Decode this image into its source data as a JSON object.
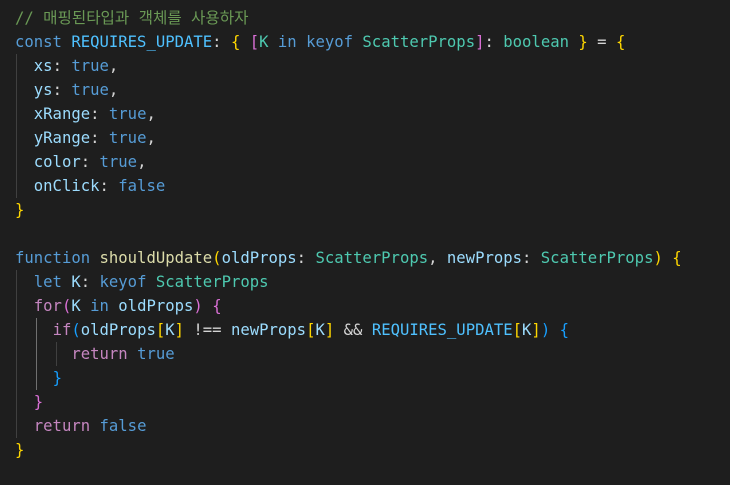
{
  "editor": {
    "colors": {
      "background": "#1e1e1e",
      "comment": "#6a9955",
      "keyword": "#569cd6",
      "control": "#c586c0",
      "variable": "#9cdcfe",
      "constant": "#4fc1ff",
      "type": "#4ec9b0",
      "function": "#dcdcaa",
      "bracket_gold": "#ffd700",
      "bracket_purple": "#da70d6",
      "bracket_blue": "#179fff",
      "plain": "#d4d4d4"
    },
    "lines": [
      [
        {
          "t": "// 매핑된타입과 객체를 사용하자",
          "c": "comment"
        }
      ],
      [
        {
          "t": "const",
          "c": "keyword"
        },
        {
          "t": " ",
          "c": "plain"
        },
        {
          "t": "REQUIRES_UPDATE",
          "c": "constant"
        },
        {
          "t": ": ",
          "c": "plain"
        },
        {
          "t": "{",
          "c": "bracket_gold"
        },
        {
          "t": " ",
          "c": "plain"
        },
        {
          "t": "[",
          "c": "bracket_purple"
        },
        {
          "t": "K",
          "c": "type"
        },
        {
          "t": " ",
          "c": "plain"
        },
        {
          "t": "in",
          "c": "keyword"
        },
        {
          "t": " ",
          "c": "plain"
        },
        {
          "t": "keyof",
          "c": "keyword"
        },
        {
          "t": " ",
          "c": "plain"
        },
        {
          "t": "ScatterProps",
          "c": "type"
        },
        {
          "t": "]",
          "c": "bracket_purple"
        },
        {
          "t": ": ",
          "c": "plain"
        },
        {
          "t": "boolean",
          "c": "type"
        },
        {
          "t": " ",
          "c": "plain"
        },
        {
          "t": "}",
          "c": "bracket_gold"
        },
        {
          "t": " = ",
          "c": "plain"
        },
        {
          "t": "{",
          "c": "bracket_gold"
        }
      ],
      [
        {
          "t": "  ",
          "c": "plain"
        },
        {
          "t": "xs",
          "c": "variable"
        },
        {
          "t": ": ",
          "c": "plain"
        },
        {
          "t": "true",
          "c": "keyword"
        },
        {
          "t": ",",
          "c": "plain"
        }
      ],
      [
        {
          "t": "  ",
          "c": "plain"
        },
        {
          "t": "ys",
          "c": "variable"
        },
        {
          "t": ": ",
          "c": "plain"
        },
        {
          "t": "true",
          "c": "keyword"
        },
        {
          "t": ",",
          "c": "plain"
        }
      ],
      [
        {
          "t": "  ",
          "c": "plain"
        },
        {
          "t": "xRange",
          "c": "variable"
        },
        {
          "t": ": ",
          "c": "plain"
        },
        {
          "t": "true",
          "c": "keyword"
        },
        {
          "t": ",",
          "c": "plain"
        }
      ],
      [
        {
          "t": "  ",
          "c": "plain"
        },
        {
          "t": "yRange",
          "c": "variable"
        },
        {
          "t": ": ",
          "c": "plain"
        },
        {
          "t": "true",
          "c": "keyword"
        },
        {
          "t": ",",
          "c": "plain"
        }
      ],
      [
        {
          "t": "  ",
          "c": "plain"
        },
        {
          "t": "color",
          "c": "variable"
        },
        {
          "t": ": ",
          "c": "plain"
        },
        {
          "t": "true",
          "c": "keyword"
        },
        {
          "t": ",",
          "c": "plain"
        }
      ],
      [
        {
          "t": "  ",
          "c": "plain"
        },
        {
          "t": "onClick",
          "c": "variable"
        },
        {
          "t": ": ",
          "c": "plain"
        },
        {
          "t": "false",
          "c": "keyword"
        }
      ],
      [
        {
          "t": "}",
          "c": "bracket_gold"
        }
      ],
      [],
      [
        {
          "t": "function",
          "c": "keyword"
        },
        {
          "t": " ",
          "c": "plain"
        },
        {
          "t": "shouldUpdate",
          "c": "function"
        },
        {
          "t": "(",
          "c": "bracket_gold"
        },
        {
          "t": "oldProps",
          "c": "variable"
        },
        {
          "t": ": ",
          "c": "plain"
        },
        {
          "t": "ScatterProps",
          "c": "type"
        },
        {
          "t": ", ",
          "c": "plain"
        },
        {
          "t": "newProps",
          "c": "variable"
        },
        {
          "t": ": ",
          "c": "plain"
        },
        {
          "t": "ScatterProps",
          "c": "type"
        },
        {
          "t": ")",
          "c": "bracket_gold"
        },
        {
          "t": " ",
          "c": "plain"
        },
        {
          "t": "{",
          "c": "bracket_gold"
        }
      ],
      [
        {
          "t": "  ",
          "c": "plain"
        },
        {
          "t": "let",
          "c": "keyword"
        },
        {
          "t": " ",
          "c": "plain"
        },
        {
          "t": "K",
          "c": "variable"
        },
        {
          "t": ": ",
          "c": "plain"
        },
        {
          "t": "keyof",
          "c": "keyword"
        },
        {
          "t": " ",
          "c": "plain"
        },
        {
          "t": "ScatterProps",
          "c": "type"
        }
      ],
      [
        {
          "t": "  ",
          "c": "plain"
        },
        {
          "t": "for",
          "c": "control"
        },
        {
          "t": "(",
          "c": "bracket_purple"
        },
        {
          "t": "K",
          "c": "variable"
        },
        {
          "t": " ",
          "c": "plain"
        },
        {
          "t": "in",
          "c": "keyword"
        },
        {
          "t": " ",
          "c": "plain"
        },
        {
          "t": "oldProps",
          "c": "variable"
        },
        {
          "t": ")",
          "c": "bracket_purple"
        },
        {
          "t": " ",
          "c": "plain"
        },
        {
          "t": "{",
          "c": "bracket_purple"
        }
      ],
      [
        {
          "t": "    ",
          "c": "plain"
        },
        {
          "t": "if",
          "c": "control"
        },
        {
          "t": "(",
          "c": "bracket_blue"
        },
        {
          "t": "oldProps",
          "c": "variable"
        },
        {
          "t": "[",
          "c": "bracket_gold"
        },
        {
          "t": "K",
          "c": "variable"
        },
        {
          "t": "]",
          "c": "bracket_gold"
        },
        {
          "t": " !== ",
          "c": "plain"
        },
        {
          "t": "newProps",
          "c": "variable"
        },
        {
          "t": "[",
          "c": "bracket_gold"
        },
        {
          "t": "K",
          "c": "variable"
        },
        {
          "t": "]",
          "c": "bracket_gold"
        },
        {
          "t": " && ",
          "c": "plain"
        },
        {
          "t": "REQUIRES_UPDATE",
          "c": "constant"
        },
        {
          "t": "[",
          "c": "bracket_gold"
        },
        {
          "t": "K",
          "c": "variable"
        },
        {
          "t": "]",
          "c": "bracket_gold"
        },
        {
          "t": ")",
          "c": "bracket_blue"
        },
        {
          "t": " ",
          "c": "plain"
        },
        {
          "t": "{",
          "c": "bracket_blue"
        }
      ],
      [
        {
          "t": "      ",
          "c": "plain"
        },
        {
          "t": "return",
          "c": "control"
        },
        {
          "t": " ",
          "c": "plain"
        },
        {
          "t": "true",
          "c": "keyword"
        }
      ],
      [
        {
          "t": "    ",
          "c": "plain"
        },
        {
          "t": "}",
          "c": "bracket_blue"
        }
      ],
      [
        {
          "t": "  ",
          "c": "plain"
        },
        {
          "t": "}",
          "c": "bracket_purple"
        }
      ],
      [
        {
          "t": "  ",
          "c": "plain"
        },
        {
          "t": "return",
          "c": "control"
        },
        {
          "t": " ",
          "c": "plain"
        },
        {
          "t": "false",
          "c": "keyword"
        }
      ],
      [
        {
          "t": "}",
          "c": "bracket_gold"
        }
      ]
    ]
  }
}
